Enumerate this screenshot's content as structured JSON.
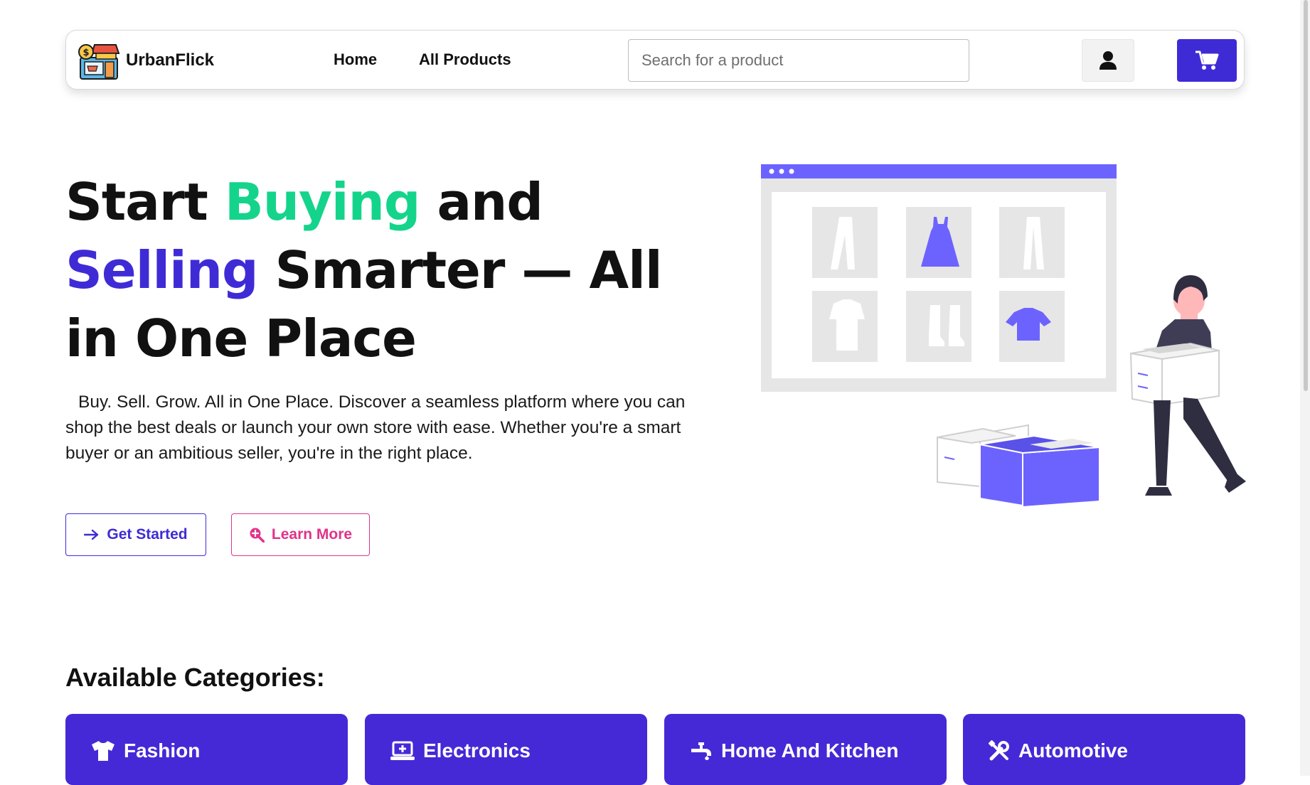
{
  "brand": {
    "name": "UrbanFlick"
  },
  "nav": {
    "home": "Home",
    "all_products": "All Products"
  },
  "search": {
    "placeholder": "Search for a product",
    "value": ""
  },
  "hero": {
    "title_part1": "Start ",
    "title_highlight1": "Buying",
    "title_part2": " and ",
    "title_highlight2": "Selling",
    "title_part3": " Smarter — All in One Place",
    "description": "Buy. Sell. Grow. All in One Place. Discover a seamless platform where you can shop the best deals or launch your own store with ease. Whether you're a smart buyer or an ambitious seller, you're in the right place.",
    "primary_button": "Get Started",
    "secondary_button": "Learn More"
  },
  "categories": {
    "heading": "Available Categories:",
    "items": [
      {
        "label": "Fashion",
        "icon": "tshirt-icon"
      },
      {
        "label": "Electronics",
        "icon": "laptop-icon"
      },
      {
        "label": "Home And Kitchen",
        "icon": "faucet-icon"
      },
      {
        "label": "Automotive",
        "icon": "tools-icon"
      }
    ]
  },
  "colors": {
    "accent_purple": "#3f2bd6",
    "accent_green": "#14d48b",
    "accent_pink": "#e0338a",
    "card_bg": "#4529d6"
  }
}
